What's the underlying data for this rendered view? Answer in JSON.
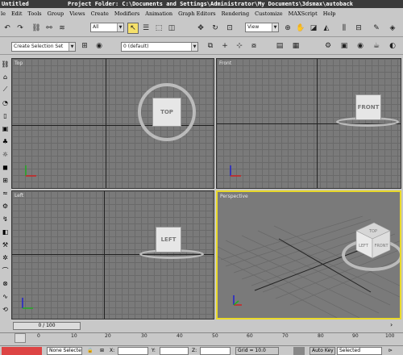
{
  "window": {
    "title": "Untitled",
    "project_folder": "Project Folder: C:\\Documents and Settings\\Administrator\\My Documents\\3dsmax\\autoback"
  },
  "menu": [
    "le",
    "Edit",
    "Tools",
    "Group",
    "Views",
    "Create",
    "Modifiers",
    "Animation",
    "Graph Editors",
    "Rendering",
    "Customize",
    "MAXScript",
    "Help"
  ],
  "toolbar": {
    "selection_filter": "All",
    "reference_coord": "View",
    "named_selection": "Create Selection Set",
    "layer": "0 (default)"
  },
  "viewports": {
    "top": {
      "label": "Top",
      "cube": "TOP"
    },
    "front": {
      "label": "Front",
      "cube": "FRONT"
    },
    "left": {
      "label": "Left",
      "cube": "LEFT"
    },
    "perspective": {
      "label": "Perspective",
      "cube_top": "TOP",
      "cube_left": "LEFT",
      "cube_front": "FRONT"
    }
  },
  "timeline": {
    "frame_display": "0 / 100",
    "ticks": [
      "0",
      "10",
      "20",
      "30",
      "40",
      "50",
      "60",
      "70",
      "80",
      "90",
      "100"
    ]
  },
  "status": {
    "selection_type": "None Selecte",
    "x_label": "X:",
    "y_label": "Y:",
    "z_label": "Z:",
    "grid": "Grid = 10.0",
    "autokey": "Auto Key",
    "selected": "Selected"
  },
  "colors": {
    "active_viewport_border": "#e9d92a",
    "viewport_bg": "#7a7a7a",
    "active_tool": "#f5e06a"
  }
}
